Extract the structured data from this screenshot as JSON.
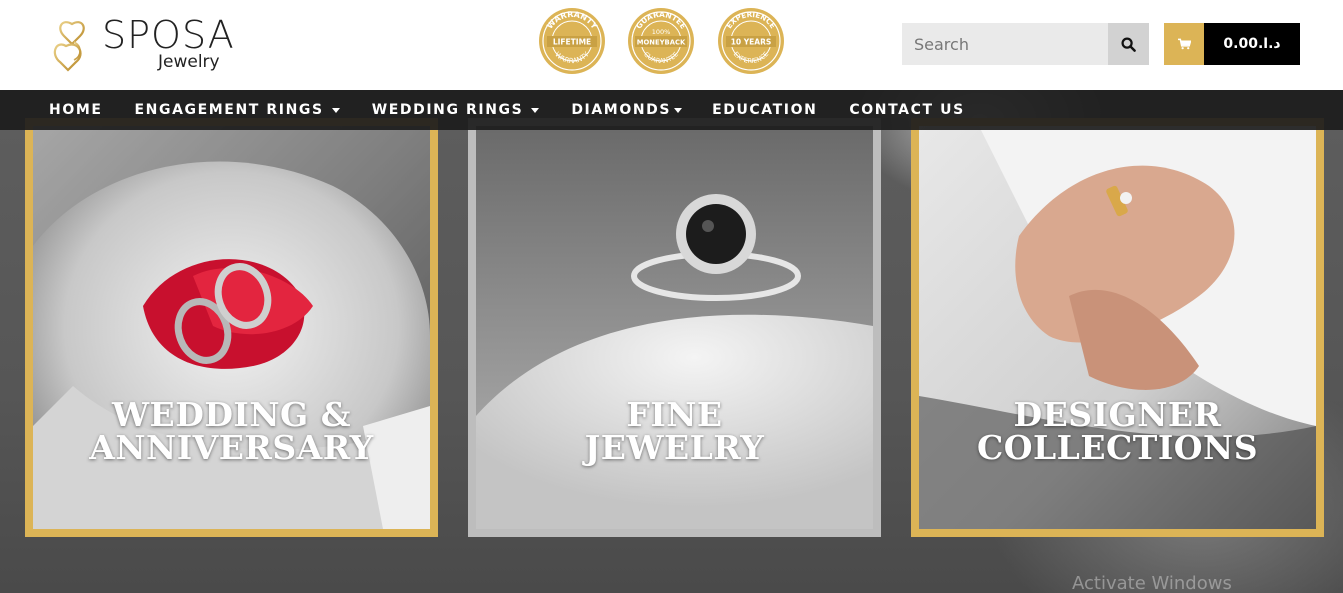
{
  "brand": {
    "name": "SPOSA",
    "tagline": "Jewelry",
    "accent": "#dcb456"
  },
  "badges": [
    {
      "top": "WARRANTY",
      "center": "LIFETIME",
      "bottom": "WARRANTY"
    },
    {
      "top": "GUARANTEE",
      "center": "MONEYBACK",
      "bottom": "GUARANTEE",
      "small": "100%"
    },
    {
      "top": "EXPERIENCE",
      "center": "10 YEARS",
      "bottom": "EXPERIENCE"
    }
  ],
  "search": {
    "placeholder": "Search",
    "icon": "search-icon"
  },
  "cart": {
    "icon": "shopping-cart-icon",
    "total": "د.ا.0.00"
  },
  "nav": {
    "items": [
      {
        "label": "HOME",
        "dropdown": false
      },
      {
        "label": "ENGAGEMENT RINGS",
        "dropdown": true
      },
      {
        "label": "WEDDING RINGS",
        "dropdown": true
      },
      {
        "label": "DIAMONDS",
        "dropdown": true
      },
      {
        "label": "EDUCATION",
        "dropdown": false
      },
      {
        "label": "CONTACT US",
        "dropdown": false
      }
    ]
  },
  "categories": [
    {
      "line1": "WEDDING &",
      "line2": "ANNIVERSARY",
      "frame": "gold"
    },
    {
      "line1": "FINE",
      "line2": "JEWELRY",
      "frame": "silver"
    },
    {
      "line1": "DESIGNER",
      "line2": "COLLECTIONS",
      "frame": "gold"
    }
  ],
  "watermark": "Activate Windows"
}
